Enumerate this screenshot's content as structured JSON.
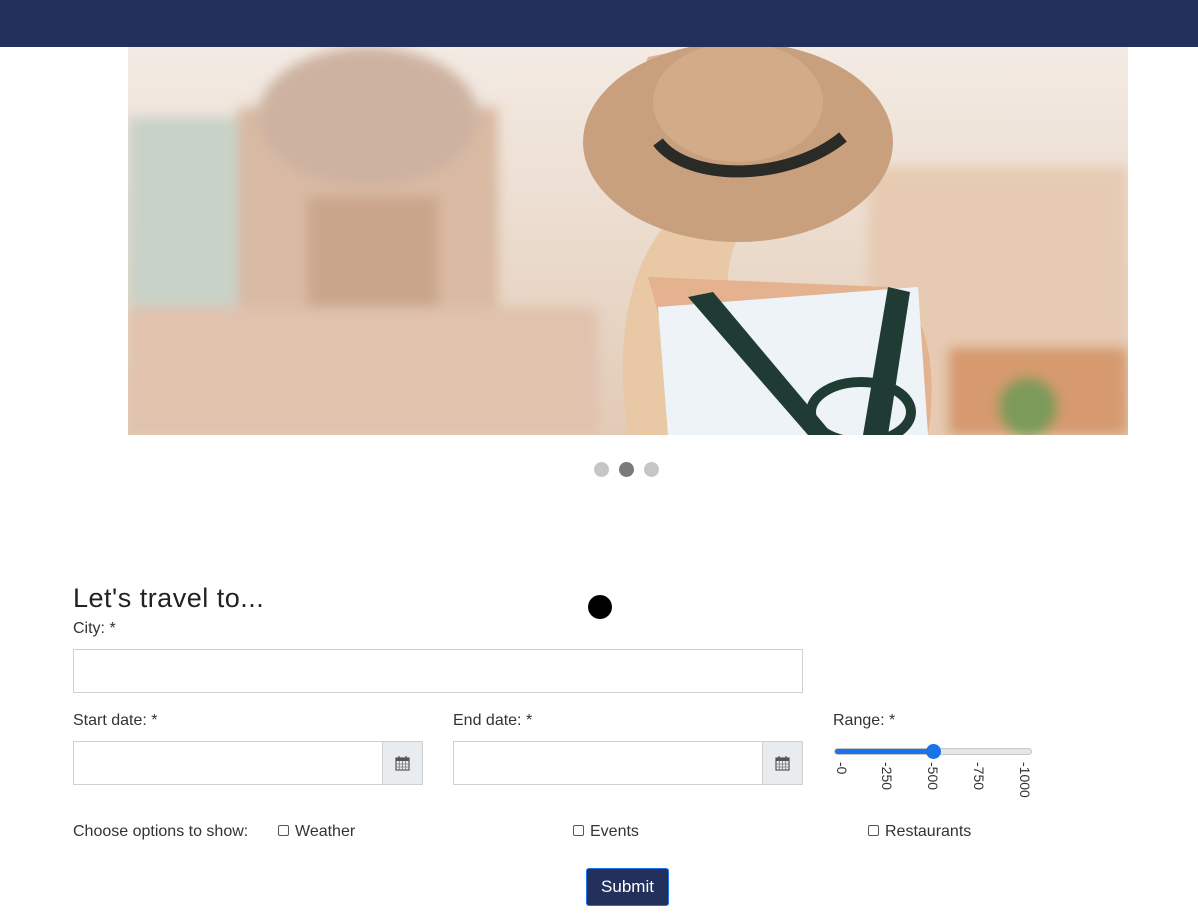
{
  "colors": {
    "navbar": "#22305b",
    "accent": "#1a73e8",
    "button": "#22305b"
  },
  "carousel": {
    "slide_count": 3,
    "active_index": 1
  },
  "form": {
    "heading": "Let's travel to...",
    "city_label": "City:",
    "start_label": "Start date:",
    "end_label": "End date:",
    "range_label": "Range:",
    "required_mark": "*",
    "range": {
      "value": 500,
      "min": 0,
      "max": 1000,
      "ticks": [
        "0",
        "250",
        "500",
        "750",
        "1000"
      ]
    },
    "options_label": "Choose options to show:",
    "options": [
      "Weather",
      "Events",
      "Restaurants"
    ],
    "submit_label": "Submit",
    "calendar_icon": "calendar-icon"
  }
}
